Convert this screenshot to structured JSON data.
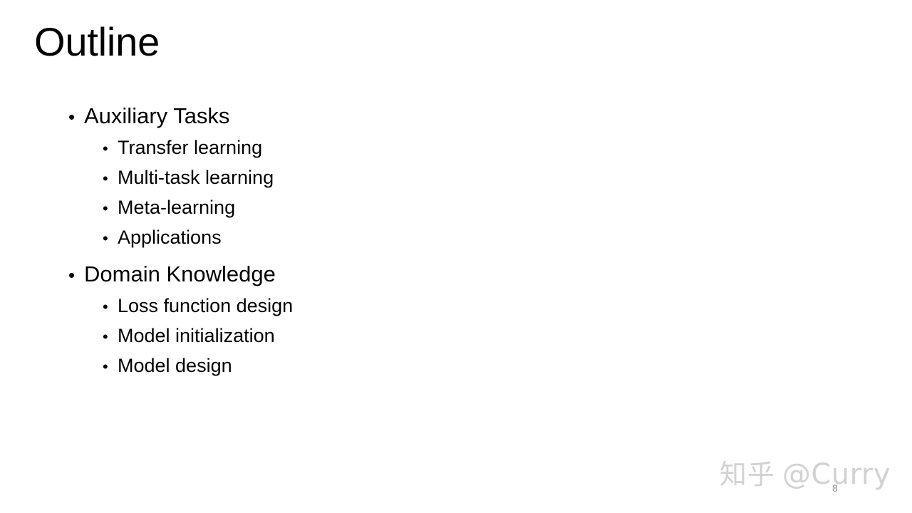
{
  "slide": {
    "title": "Outline",
    "page_number": "8",
    "background_color": "#ffffff",
    "text_color": "#000000"
  },
  "outline": {
    "bullet_marker": "•",
    "groups": [
      {
        "heading": "Auxiliary Tasks",
        "items": [
          "Transfer learning",
          "Multi-task learning",
          "Meta-learning",
          "Applications"
        ]
      },
      {
        "heading": "Domain Knowledge",
        "items": [
          "Loss function design",
          "Model initialization",
          "Model design"
        ]
      }
    ]
  },
  "watermark": {
    "site": "知乎",
    "handle": "@Curry",
    "color": "#d2d2d2"
  }
}
